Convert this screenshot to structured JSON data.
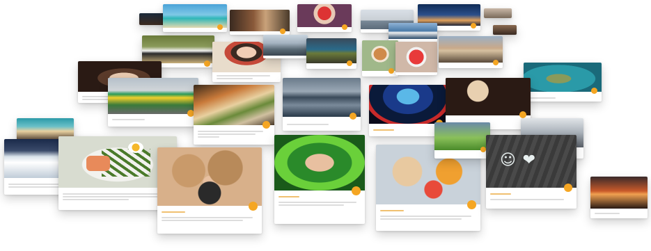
{
  "cards": [
    {
      "id": "c1",
      "photo": "dark-thumb"
    },
    {
      "id": "c2",
      "photo": "tropical-beach"
    },
    {
      "id": "c3",
      "photo": "group-selfie"
    },
    {
      "id": "c4",
      "photo": "red-hat-portrait"
    },
    {
      "id": "c5",
      "photo": "golden-gate"
    },
    {
      "id": "c6",
      "photo": "sunset-sky"
    },
    {
      "id": "c7",
      "photo": "small-dark-thumb"
    },
    {
      "id": "c8",
      "photo": "cow-field"
    },
    {
      "id": "c9",
      "photo": "woman-eating"
    },
    {
      "id": "c10",
      "photo": "city-building"
    },
    {
      "id": "c11",
      "photo": "harbor-cityscape"
    },
    {
      "id": "c12",
      "photo": "corgi"
    },
    {
      "id": "c13",
      "photo": "ice-cream-cup"
    },
    {
      "id": "c14",
      "photo": "lounge-chairs"
    },
    {
      "id": "c15",
      "photo": "sea-turtle"
    },
    {
      "id": "c16",
      "photo": "baby-sleeping"
    },
    {
      "id": "c17",
      "photo": "runners"
    },
    {
      "id": "c18",
      "photo": "sandwich-plate"
    },
    {
      "id": "c19",
      "photo": "lake-mountains"
    },
    {
      "id": "c20",
      "photo": "neon-bridge"
    },
    {
      "id": "c21",
      "photo": "pastry-closeup"
    },
    {
      "id": "c22",
      "photo": "teal-lake"
    },
    {
      "id": "c23",
      "photo": "hockey-rink"
    },
    {
      "id": "c24",
      "photo": "asparagus-dish"
    },
    {
      "id": "c25",
      "photo": "teddy-bears"
    },
    {
      "id": "c26",
      "photo": "selfie-green"
    },
    {
      "id": "c27",
      "photo": "flatbread-fruit"
    },
    {
      "id": "c28",
      "photo": "golfer"
    },
    {
      "id": "c29",
      "photo": "skateboarder"
    },
    {
      "id": "c30",
      "photo": "love-chalk"
    },
    {
      "id": "c31",
      "photo": "orange-sunset"
    }
  ],
  "badge_color": "#f5a623"
}
